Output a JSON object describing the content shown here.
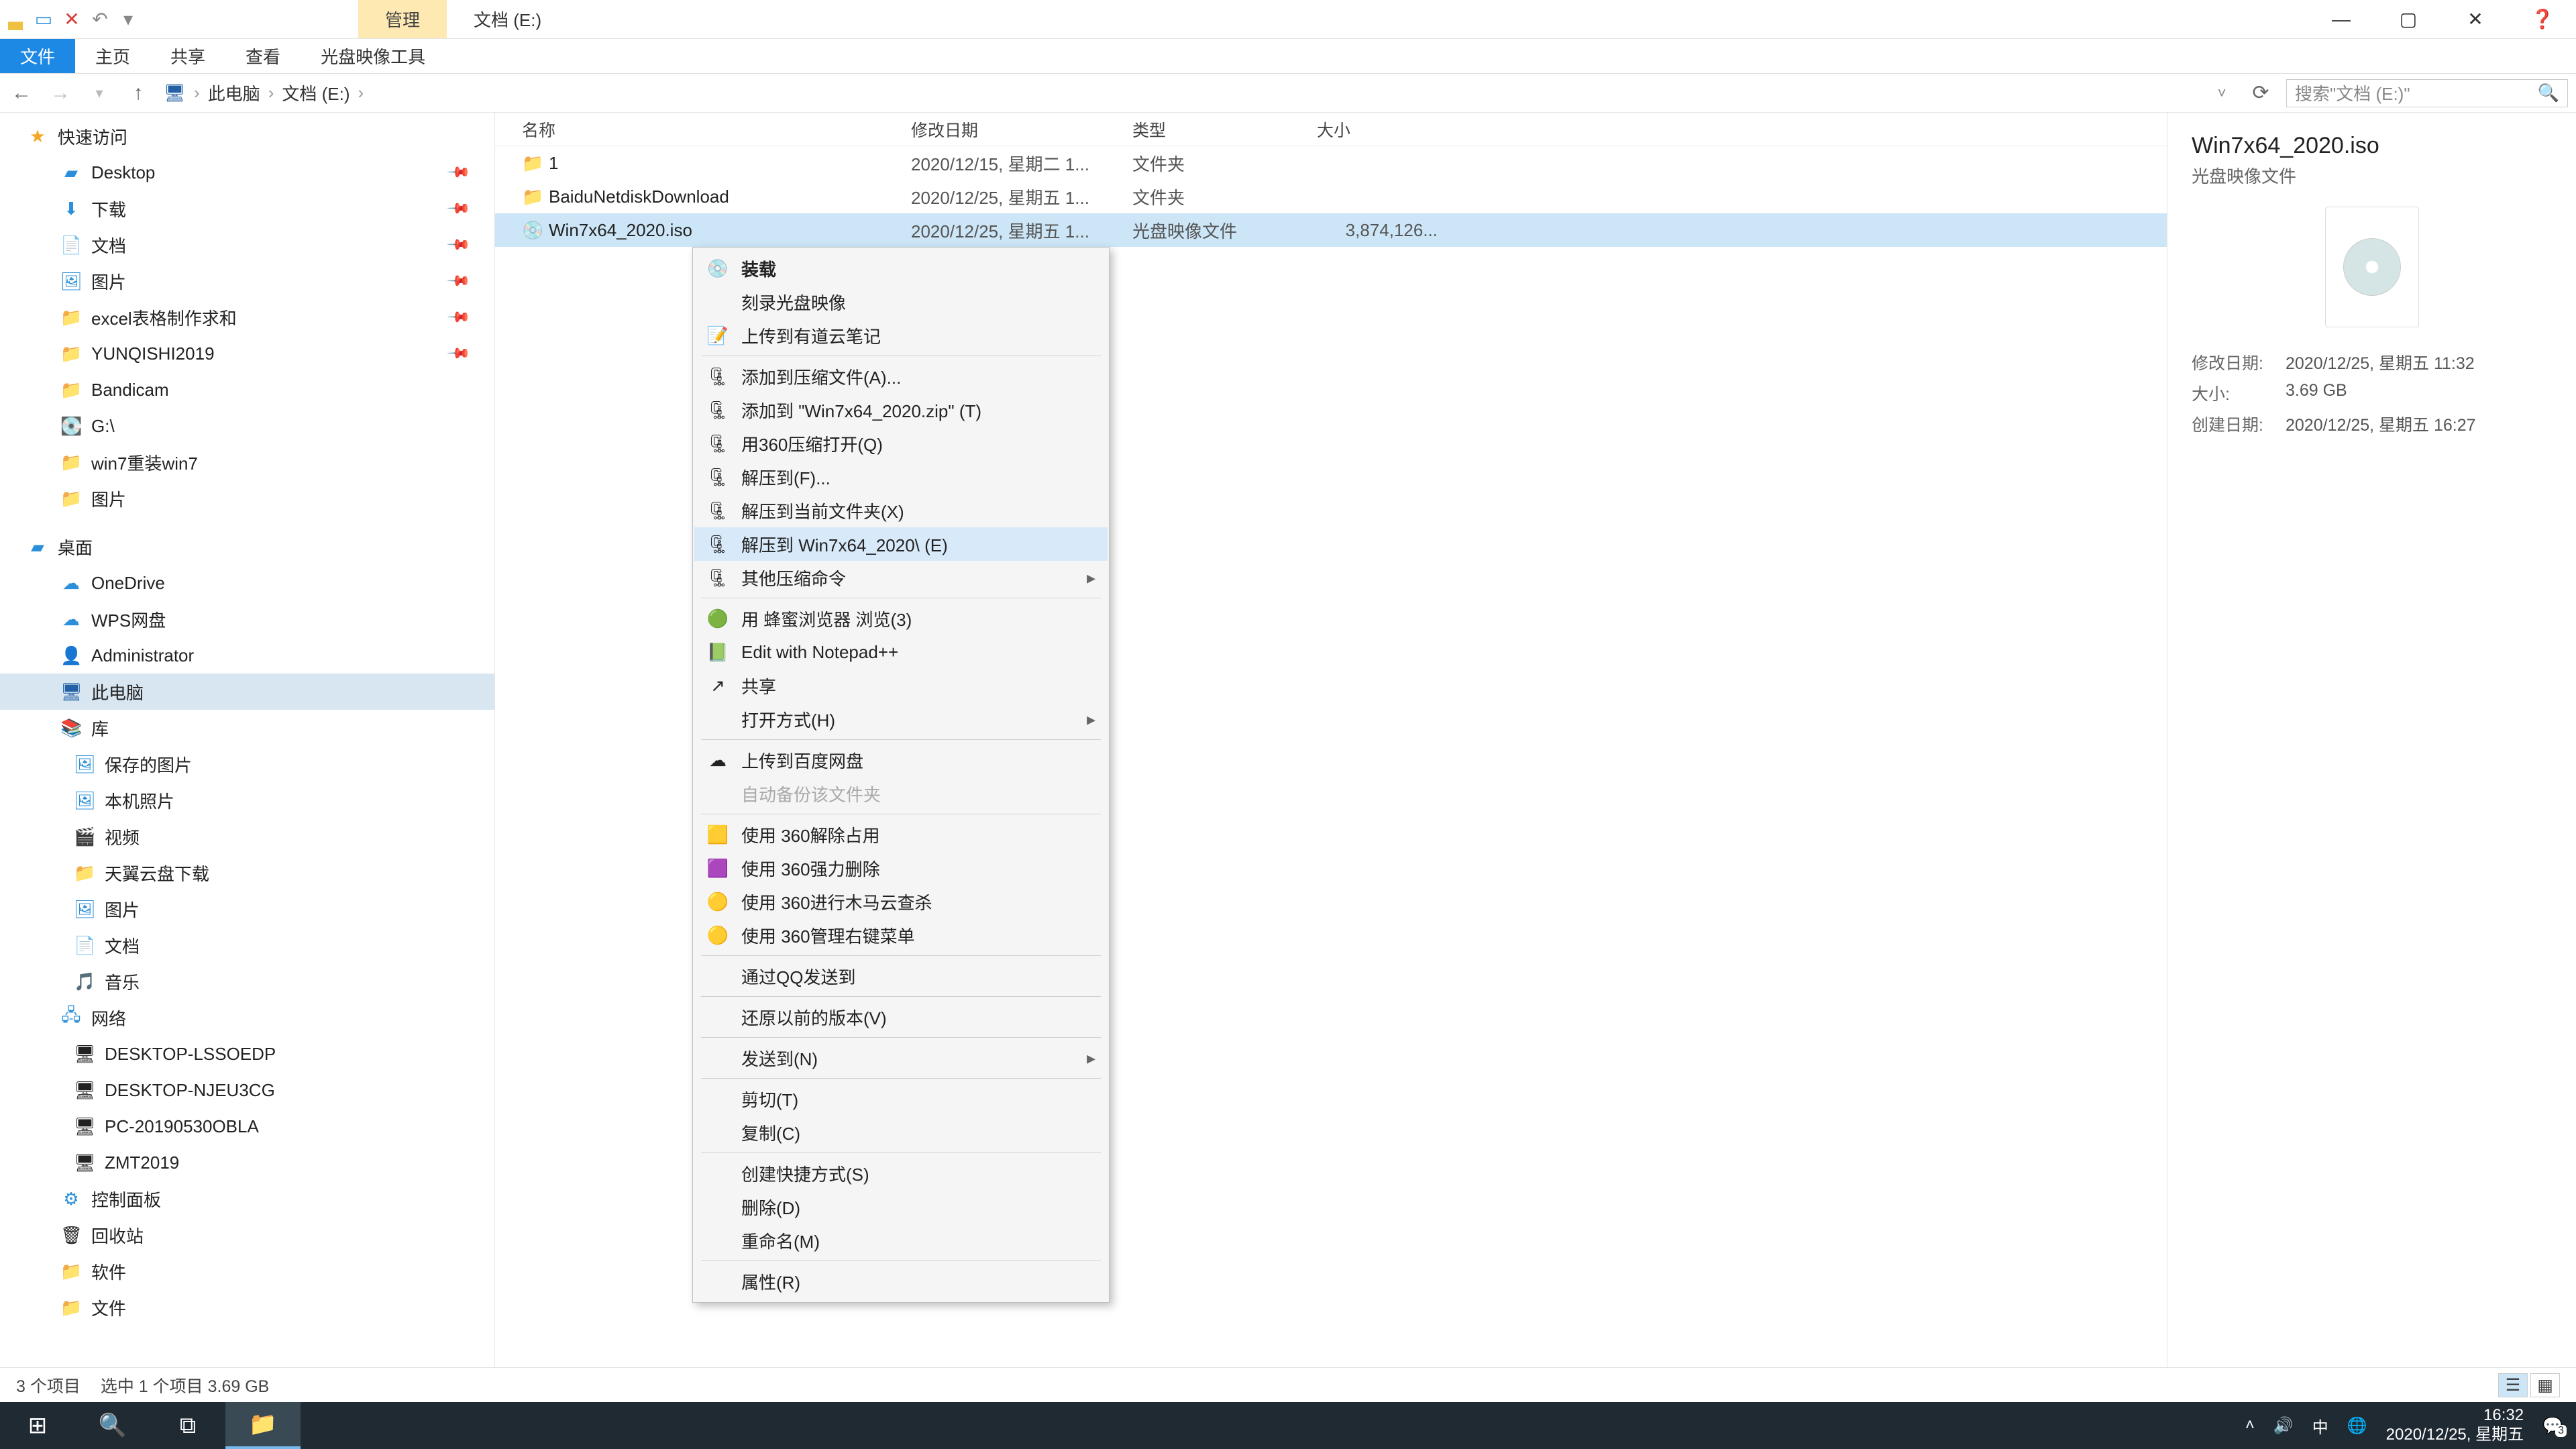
{
  "title_context": "管理",
  "title_path": "文档 (E:)",
  "ribbon": {
    "file": "文件",
    "home": "主页",
    "share": "共享",
    "view": "查看",
    "ctx": "光盘映像工具"
  },
  "breadcrumb": [
    "此电脑",
    "文档 (E:)"
  ],
  "search_placeholder": "搜索\"文档 (E:)\"",
  "columns": {
    "name": "名称",
    "date": "修改日期",
    "type": "类型",
    "size": "大小"
  },
  "nav": {
    "quick": "快速访问",
    "quick_items": [
      "Desktop",
      "下载",
      "文档",
      "图片",
      "excel表格制作求和",
      "YUNQISHI2019",
      "Bandicam",
      "G:\\",
      "win7重装win7",
      "图片"
    ],
    "desktop": "桌面",
    "desktop_items": [
      "OneDrive",
      "WPS网盘",
      "Administrator",
      "此电脑",
      "库"
    ],
    "lib_items": [
      "保存的图片",
      "本机照片",
      "视频",
      "天翼云盘下载",
      "图片",
      "文档",
      "音乐"
    ],
    "network": "网络",
    "net_items": [
      "DESKTOP-LSSOEDP",
      "DESKTOP-NJEU3CG",
      "PC-20190530OBLA",
      "ZMT2019"
    ],
    "cp": "控制面板",
    "recycle": "回收站",
    "soft": "软件",
    "filesf": "文件"
  },
  "rows": [
    {
      "name": "1",
      "date": "2020/12/15, 星期二 1...",
      "type": "文件夹",
      "size": ""
    },
    {
      "name": "BaiduNetdiskDownload",
      "date": "2020/12/25, 星期五 1...",
      "type": "文件夹",
      "size": ""
    },
    {
      "name": "Win7x64_2020.iso",
      "date": "2020/12/25, 星期五 1...",
      "type": "光盘映像文件",
      "size": "3,874,126..."
    }
  ],
  "context_menu": [
    {
      "label": "装载",
      "icon": "disc",
      "bold": true
    },
    {
      "label": "刻录光盘映像"
    },
    {
      "label": "上传到有道云笔记",
      "icon": "note"
    },
    {
      "sep": true
    },
    {
      "label": "添加到压缩文件(A)...",
      "icon": "zip"
    },
    {
      "label": "添加到 \"Win7x64_2020.zip\" (T)",
      "icon": "zip"
    },
    {
      "label": "用360压缩打开(Q)",
      "icon": "zip"
    },
    {
      "label": "解压到(F)...",
      "icon": "zip"
    },
    {
      "label": "解压到当前文件夹(X)",
      "icon": "zip"
    },
    {
      "label": "解压到 Win7x64_2020\\ (E)",
      "icon": "zip",
      "hover": true
    },
    {
      "label": "其他压缩命令",
      "icon": "zip",
      "arrow": true
    },
    {
      "sep": true
    },
    {
      "label": "用 蜂蜜浏览器 浏览(3)",
      "icon": "green"
    },
    {
      "label": "Edit with Notepad++",
      "icon": "npp"
    },
    {
      "label": "共享",
      "icon": "share"
    },
    {
      "label": "打开方式(H)",
      "arrow": true
    },
    {
      "sep": true
    },
    {
      "label": "上传到百度网盘",
      "icon": "cloud"
    },
    {
      "label": "自动备份该文件夹",
      "disabled": true
    },
    {
      "sep": true
    },
    {
      "label": "使用 360解除占用",
      "icon": "y360"
    },
    {
      "label": "使用 360强力删除",
      "icon": "y360p"
    },
    {
      "label": "使用 360进行木马云查杀",
      "icon": "y360g"
    },
    {
      "label": "使用 360管理右键菜单",
      "icon": "y360g"
    },
    {
      "sep": true
    },
    {
      "label": "通过QQ发送到"
    },
    {
      "sep": true
    },
    {
      "label": "还原以前的版本(V)"
    },
    {
      "sep": true
    },
    {
      "label": "发送到(N)",
      "arrow": true
    },
    {
      "sep": true
    },
    {
      "label": "剪切(T)"
    },
    {
      "label": "复制(C)"
    },
    {
      "sep": true
    },
    {
      "label": "创建快捷方式(S)"
    },
    {
      "label": "删除(D)"
    },
    {
      "label": "重命名(M)"
    },
    {
      "sep": true
    },
    {
      "label": "属性(R)"
    }
  ],
  "preview": {
    "title": "Win7x64_2020.iso",
    "subtitle": "光盘映像文件",
    "modlabel": "修改日期:",
    "mod": "2020/12/25, 星期五 11:32",
    "sizelabel": "大小:",
    "size": "3.69 GB",
    "createdlabel": "创建日期:",
    "created": "2020/12/25, 星期五 16:27"
  },
  "status": {
    "count": "3 个项目",
    "sel": "选中 1 个项目  3.69 GB"
  },
  "taskbar": {
    "ime": "中",
    "time": "16:32",
    "date": "2020/12/25, 星期五",
    "notif": "3"
  }
}
